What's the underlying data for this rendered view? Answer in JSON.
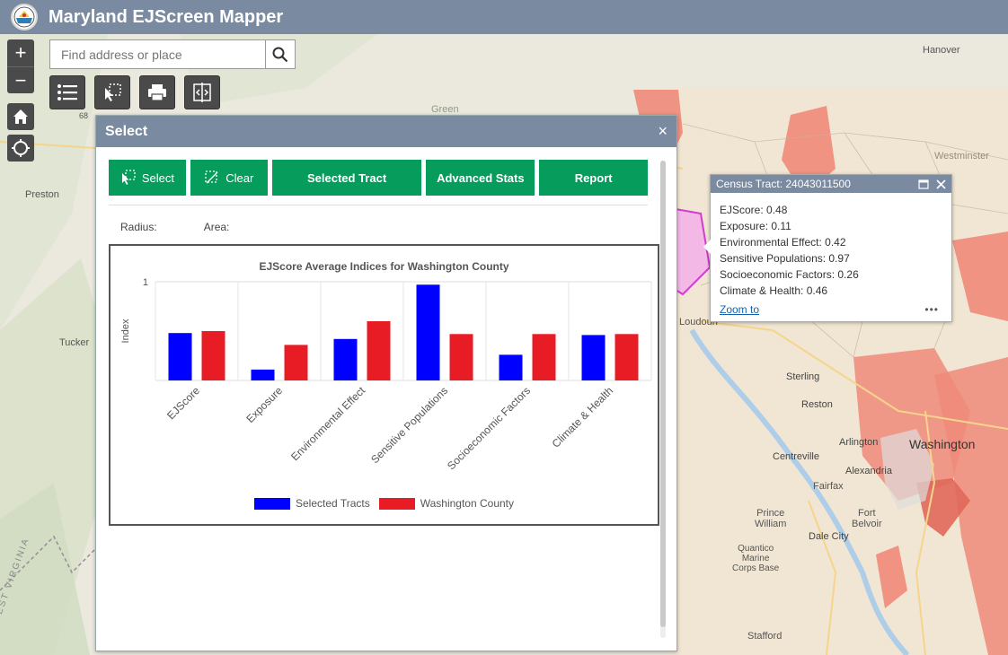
{
  "app": {
    "title": "Maryland EJScreen Mapper"
  },
  "search": {
    "placeholder": "Find address or place"
  },
  "controls": {
    "zoom_in": "+",
    "zoom_out": "−"
  },
  "panel": {
    "title": "Select",
    "close": "×",
    "buttons": {
      "select": "Select",
      "clear": "Clear",
      "selected_tract": "Selected Tract",
      "advanced_stats": "Advanced Stats",
      "report": "Report"
    },
    "radius_label": "Radius:",
    "area_label": "Area:"
  },
  "chart_data": {
    "type": "bar",
    "title": "EJScore Average Indices for Washington County",
    "ylabel": "Index",
    "ytick": "1",
    "ylim": [
      0,
      1
    ],
    "categories": [
      "EJScore",
      "Exposure",
      "Environmental Effect",
      "Sensitive Populations",
      "Socioeconomic Factors",
      "Climate & Health"
    ],
    "series": [
      {
        "name": "Selected Tracts",
        "color": "#0000ff",
        "values": [
          0.48,
          0.11,
          0.42,
          0.97,
          0.26,
          0.46
        ]
      },
      {
        "name": "Washington County",
        "color": "#e81c24",
        "values": [
          0.5,
          0.36,
          0.6,
          0.47,
          0.47,
          0.47
        ]
      }
    ]
  },
  "popup": {
    "title": "Census Tract: 24043011500",
    "rows": [
      "EJScore: 0.48",
      "Exposure: 0.11",
      "Environmental Effect: 0.42",
      "Sensitive Populations: 0.97",
      "Socioeconomic Factors: 0.26",
      "Climate & Health: 0.46"
    ],
    "zoom_to": "Zoom to",
    "more": "•••"
  },
  "map_labels": {
    "hanover": "Hanover",
    "preston": "Preston",
    "tucker": "Tucker",
    "loudoun": "Loudoun",
    "sterling": "Sterling",
    "reston": "Reston",
    "arlington": "Arlington",
    "washington": "Washington",
    "centreville": "Centreville",
    "alexandria": "Alexandria",
    "fairfax": "Fairfax",
    "prince_william": "Prince\nWilliam",
    "fort_belvoir": "Fort\nBelvoir",
    "dale_city": "Dale City",
    "quantico": "Quantico\nMarine\nCorps Base",
    "stafford": "Stafford",
    "westminster": "Westminster",
    "west_virginia": "WEST VIRGINIA",
    "green": "Green",
    "num_68": "68"
  }
}
